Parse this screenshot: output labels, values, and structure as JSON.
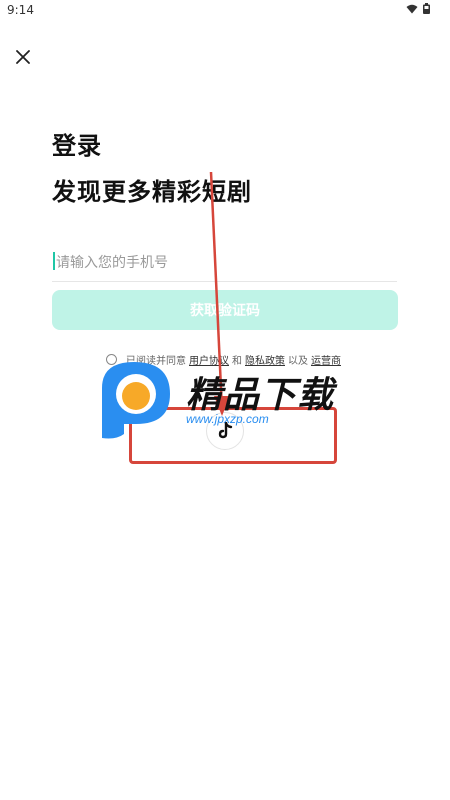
{
  "status_bar": {
    "time": "9:14"
  },
  "header": {
    "close_icon": "close-icon"
  },
  "main": {
    "title": "登录",
    "subtitle": "发现更多精彩短剧",
    "phone_placeholder": "请输入您的手机号",
    "phone_value": "",
    "code_button": "获取验证码",
    "agreement": {
      "prefix": "已阅读并同意",
      "user_agreement": "用户协议",
      "and": "和",
      "privacy_policy": "隐私政策",
      "and_also": "以及",
      "operator": "运营商"
    },
    "third_party_login_icon": "douyin-icon"
  },
  "watermark": {
    "brand": "精品下载",
    "url": "www.jpxzp.com"
  },
  "colors": {
    "accent": "#1fc6a6",
    "button_disabled": "#bff3e7",
    "annotation": "#d6463b",
    "watermark_orange": "#f7a928",
    "watermark_blue": "#2a8ef0"
  }
}
